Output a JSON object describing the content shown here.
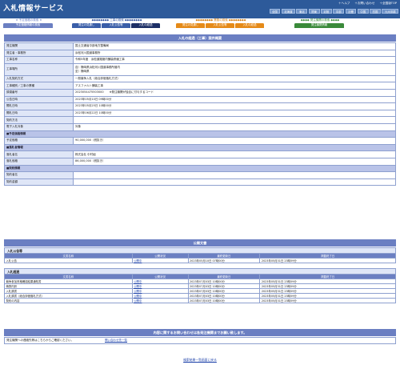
{
  "header": {
    "title": "入札情報サービス",
    "links": [
      "＋ヘルプ",
      "＋お問い合わせ",
      "＋全国版TOP"
    ],
    "regions": [
      "全国",
      "北海道",
      "東北",
      "関東",
      "北陸",
      "中部",
      "近畿",
      "中国",
      "四国",
      "九州沖縄"
    ]
  },
  "nav": {
    "groups": [
      {
        "title": "★ 予定価格の検索 ★",
        "tabs": [
          "予定価格情報の検索"
        ]
      },
      {
        "title": "◆◆◆◆◆◆◆◆ 工事の検索 ◆◆◆◆◆◆◆◆",
        "tabs": [
          "発注の見通し",
          "入札公告等",
          "入札の経過"
        ]
      },
      {
        "title": "◆◆◆◆◆◆◆◆ 業務の検索 ◆◆◆◆◆◆◆◆",
        "tabs": [
          "発注の見通し",
          "入札公告等",
          "入札の経過"
        ]
      },
      {
        "title": "◆◆◆◆ 発注機関の検索 ◆◆◆◆",
        "tabs": [
          "発注機関情報"
        ]
      }
    ]
  },
  "detail": {
    "title": "入札の経過（工事）案件概要",
    "rows": [
      {
        "k": "発注機関",
        "v": "国土交通省中部地方整備局"
      },
      {
        "k": "発注者・事務所",
        "v": "浜松河川国道事務所"
      },
      {
        "k": "工事名称",
        "v": "令和5年度　浜松道路管内舗装修繕工事"
      },
      {
        "k": "工事場所",
        "v": "自）静岡県浜松河川国道事務所管内\n至）静岡県",
        "tall": true
      },
      {
        "k": "入札契約方式",
        "v": "一般競争入札（総合評価落札方式）"
      },
      {
        "k": "工事種別／工事の業種",
        "v": "アスファルト舗装工事"
      },
      {
        "k": "調達番号",
        "v": "2023054475503000　　※発注機関が独自に付与するコード"
      },
      {
        "k": "公告日時",
        "v": "2023年05月10日 09時00分"
      },
      {
        "k": "開札日時",
        "v": "2023年05月25日 10時00分"
      },
      {
        "k": "開札日時",
        "v": "2023年06月22日 10時00分"
      },
      {
        "k": "契約方法",
        "v": ""
      },
      {
        "k": "電子入札対象",
        "v": "対象"
      }
    ],
    "sections": [
      {
        "title": "■予定価格情報",
        "rows": [
          {
            "k": "予定価格",
            "v": "90,000,000（税抜き）"
          }
        ]
      },
      {
        "title": "■落札者情報",
        "rows": [
          {
            "k": "落札者名",
            "v": "株式会社 中村組"
          },
          {
            "k": "落札価格",
            "v": "86,000,000（税抜き）"
          }
        ]
      },
      {
        "title": "■契約情報",
        "rows": [
          {
            "k": "契約者名",
            "v": ""
          },
          {
            "k": "契約金額",
            "v": ""
          }
        ]
      }
    ]
  },
  "pub": {
    "title": "公開文書",
    "cols": [
      "文書名称",
      "公開状況",
      "最終更新日",
      "掲載終了日"
    ],
    "groups": [
      {
        "name": "入札公告等",
        "rows": [
          [
            "入札公告",
            "公開中",
            "2023年05月10日 07時00分",
            "2023年05月31日 23時59分"
          ]
        ]
      },
      {
        "name": "入札経過",
        "rows": [
          [
            "競争参加資格確認結果通知書",
            "公開中",
            "2023年07月03日 10時00分",
            "2023年05月31日 23時59分"
          ],
          [
            "積算内訳",
            "公開中",
            "2023年07月03日 10時00分",
            "2023年05月31日 23時59分"
          ],
          [
            "入札調書",
            "公開中",
            "2023年07月03日 10時00分",
            "2023年05月31日 23時59分"
          ],
          [
            "入札調書（総合評価落札方式）",
            "公開中",
            "2023年07月03日 10時00分",
            "2023年05月31日 23時59分"
          ],
          [
            "契約の内容",
            "公開中",
            "2023年07月03日 10時00分",
            "2023年05月31日 23時59分"
          ]
        ]
      }
    ]
  },
  "inquiry": {
    "title": "内容に関するお問い合わせは各発注機関までお願い致します。",
    "text": "発注機関への連絡先等はこちらからご確認ください。",
    "link": "問い合わせ先一覧"
  },
  "back": "検索結果一覧画面に戻る"
}
